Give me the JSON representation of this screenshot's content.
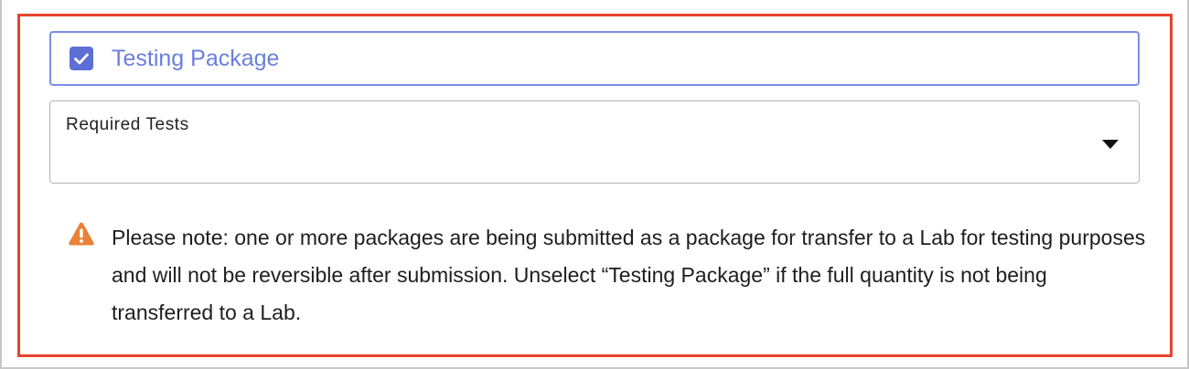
{
  "testing_package": {
    "label": "Testing Package",
    "checked": true,
    "icon": "checkmark-icon"
  },
  "required_tests": {
    "label": "Required Tests",
    "value": "",
    "icon": "caret-down-icon"
  },
  "notice": {
    "icon": "warning-icon",
    "text": "Please note: one or more packages are being submitted as a package for transfer to a Lab for testing purposes and will not be reversible after submission. Unselect “Testing Package” if the full quantity is not being transferred to a Lab."
  },
  "colors": {
    "highlight_border": "#e8442b",
    "accent": "#5b6fd6",
    "warning": "#e8823a"
  }
}
